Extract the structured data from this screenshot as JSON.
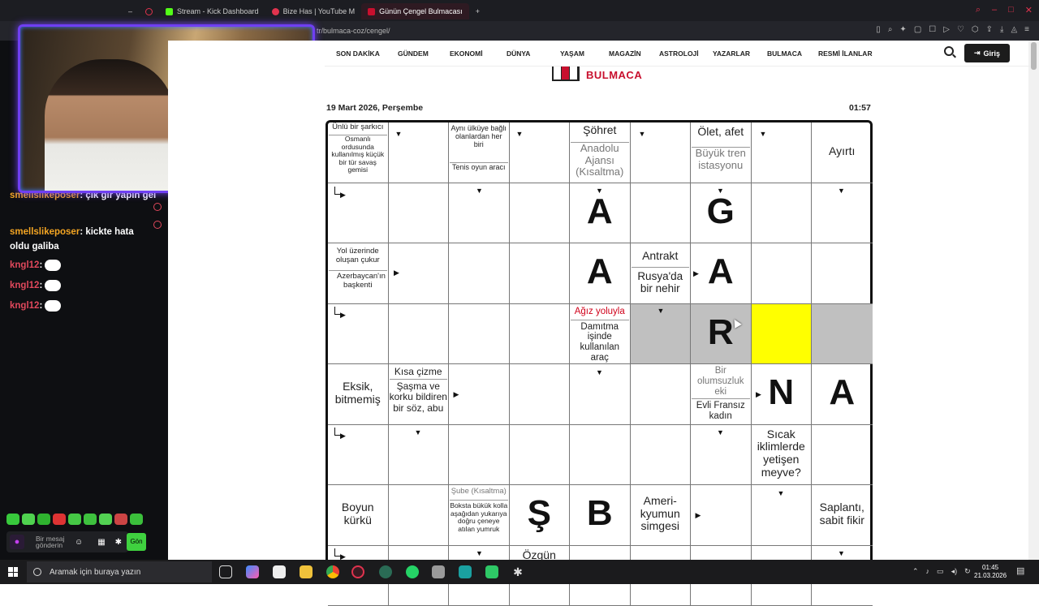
{
  "browser": {
    "tabs": [
      {
        "label": "Stream - Kick Dashboard",
        "color": "#53fc18"
      },
      {
        "label": "Bize Has | YouTube M",
        "color": "#e0334e"
      },
      {
        "label": "Günün Çengel Bulmacası",
        "color": "#c8102e"
      }
    ],
    "new_tab_label": "+",
    "address": "tr/bulmaca-coz/cengel/"
  },
  "chat": {
    "messages": [
      {
        "user": "smellslikeposer",
        "text": ": çık gir yapın gel"
      },
      {
        "user": "smellslikeposer",
        "text": ": kickte hata oldu galiba"
      },
      {
        "user": "kngl12",
        "text": ":"
      },
      {
        "user": "kngl12",
        "text": ":"
      },
      {
        "user": "kngl12",
        "text": ":"
      }
    ],
    "input_placeholder": "Bir mesaj gönderin",
    "send_label": "Gön"
  },
  "nav": {
    "items": [
      "SON DAKİKA",
      "GÜNDEM",
      "EKONOMİ",
      "DÜNYA",
      "YAŞAM",
      "MAGAZİN",
      "ASTROLOJİ",
      "YAZARLAR",
      "BULMACA",
      "RESMİ İLANLAR"
    ],
    "login_label": "Giriş"
  },
  "logo_text": "BULMACA",
  "date": "19 Mart 2026, Perşembe",
  "time": "01:57",
  "puzzle": {
    "letters": {
      "A1": "A",
      "A2": "A",
      "G": "G",
      "A3": "A",
      "R": "R",
      "N": "N",
      "A4": "A",
      "S": "Ş",
      "B": "B"
    },
    "clues": {
      "c1a": "Ünlü bir şarkıcı",
      "c1b": "Osmanlı ordusunda kullanılmış küçük bir tür savaş gemisi",
      "c2a": "Aynı ülküye bağlı olanlardan her biri",
      "c2b": "Tenis oyun aracı",
      "c3a": "Şöhret",
      "c3b": "Anadolu Ajansı (Kısaltma)",
      "c4a": "Ölet, afet",
      "c4b": "Büyük tren istasyonu",
      "c5": "Ayırtı",
      "c6a": "Yol üzerinde oluşan çukur",
      "c6b": "Azerbaycan'ın başkenti",
      "c7a": "Antrakt",
      "c7b": "Rusya'da bir nehir",
      "c8a": "Ağız yoluyla",
      "c8b": "Damıtma işinde kullanılan araç",
      "c9": "Eksik, bitmemiş",
      "c10a": "Kısa çizme",
      "c10b": "Şaşma ve korku bildiren bir söz, abu",
      "c11a": "Bir olumsuzluk eki",
      "c11b": "Evli Fransız kadın",
      "c12": "Sıcak iklimlerde yetişen meyve?",
      "c13": "Boyun kürkü",
      "c14a": "Şube (Kısaltma)",
      "c14b": "Boksta bükük kolla aşağıdan yukarıya doğru çeneye atılan yumruk",
      "c15": "Ameri-kyumun simgesi",
      "c16": "Saplantı, sabit fikir",
      "c17": "Özgün"
    }
  },
  "taskbar": {
    "search_placeholder": "Aramak için buraya yazın",
    "clock_time": "01:45",
    "clock_date": "21.03.2026"
  }
}
